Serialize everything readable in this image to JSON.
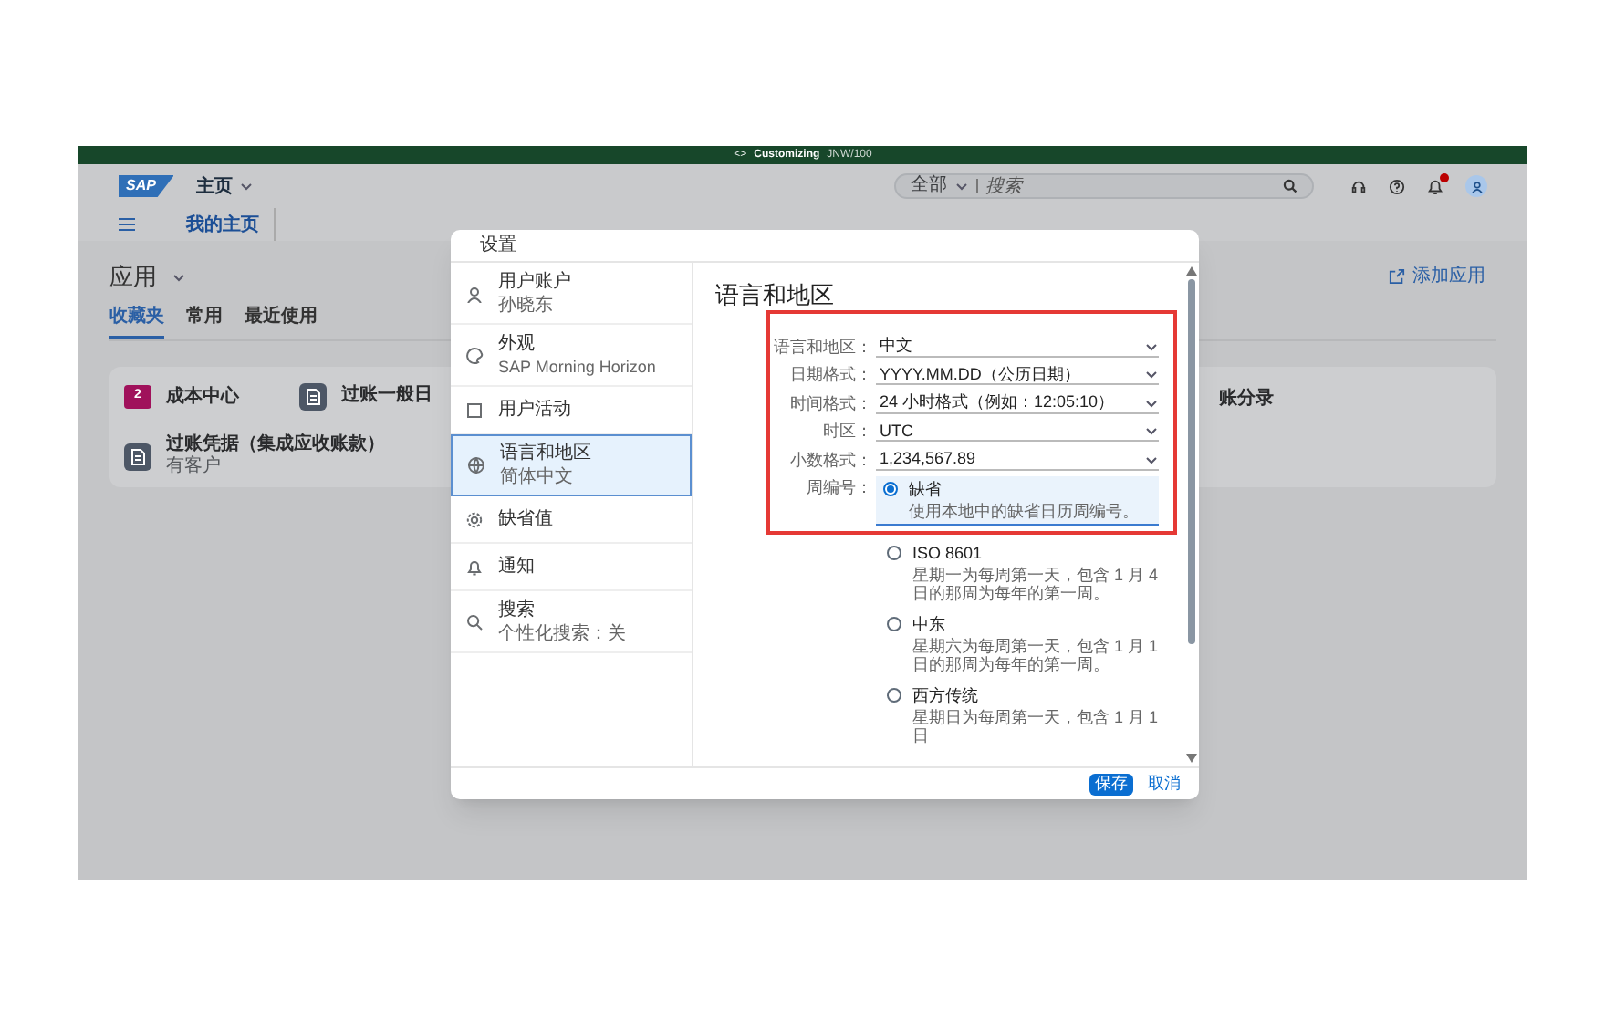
{
  "system_bar": {
    "code_icon": "<>",
    "title": "Customizing",
    "client": "JNW/100"
  },
  "shell": {
    "logo": "SAP",
    "home_menu": "主页",
    "search": {
      "scope": "全部",
      "placeholder": "搜索"
    }
  },
  "nav_tabs": [
    {
      "label": "我的主页",
      "selected": true
    }
  ],
  "apps": {
    "title": "应用",
    "add_link": "添加应用",
    "tabs": [
      {
        "label": "收藏夹",
        "selected": true
      },
      {
        "label": "常用",
        "selected": false
      },
      {
        "label": "最近使用",
        "selected": false
      }
    ],
    "tiles": [
      {
        "kind": "folder",
        "title": "成本中心",
        "badge": "2"
      },
      {
        "kind": "app",
        "title": "过账一般日"
      },
      {
        "kind": "text",
        "title": "账分录"
      },
      {
        "kind": "app",
        "title": "过账凭据（集成应收账款）",
        "subtitle": "有客户"
      }
    ]
  },
  "dialog": {
    "title": "设置",
    "nav": [
      {
        "label": "用户账户",
        "sub": "孙晓东",
        "selected": false
      },
      {
        "label": "外观",
        "sub": "SAP Morning Horizon",
        "selected": false
      },
      {
        "label": "用户活动",
        "selected": false
      },
      {
        "label": "语言和地区",
        "sub": "简体中文",
        "selected": true
      },
      {
        "label": "缺省值",
        "selected": false
      },
      {
        "label": "通知",
        "selected": false
      },
      {
        "label": "搜索",
        "sub": "个性化搜索：关",
        "selected": false
      }
    ],
    "section_title": "语言和地区",
    "fields": [
      {
        "label": "语言和地区：",
        "value": "中文"
      },
      {
        "label": "日期格式：",
        "value": "YYYY.MM.DD（公历日期）"
      },
      {
        "label": "时间格式：",
        "value": "24 小时格式（例如：12:05:10）"
      },
      {
        "label": "时区：",
        "value": "UTC"
      },
      {
        "label": "小数格式：",
        "value": "1,234,567.89"
      }
    ],
    "week_numbering": {
      "label": "周编号：",
      "options": [
        {
          "title": "缺省",
          "description": "使用本地中的缺省日历周编号。",
          "selected": true
        },
        {
          "title": "ISO 8601",
          "description": "星期一为每周第一天，包含 1 月 4 日的那周为每年的第一周。",
          "selected": false
        },
        {
          "title": "中东",
          "description": "星期六为每周第一天，包含 1 月 1 日的那周为每年的第一周。",
          "selected": false
        },
        {
          "title": "西方传统",
          "description": "星期日为每周第一天，包含 1 月 1 日",
          "selected": false
        }
      ]
    },
    "buttons": [
      {
        "label": "保存",
        "kind": "primary"
      },
      {
        "label": "取消",
        "kind": "transparent"
      }
    ]
  }
}
